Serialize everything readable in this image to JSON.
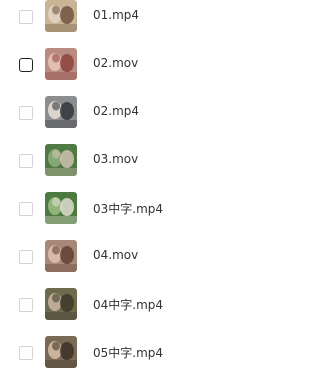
{
  "files": [
    {
      "name": "01.mp4",
      "checked": false,
      "hovered": false,
      "thumb": {
        "bg": "#c9b596",
        "a": "#e4d6c6",
        "b": "#6a4f3c"
      }
    },
    {
      "name": "02.mov",
      "checked": false,
      "hovered": true,
      "thumb": {
        "bg": "#b98b82",
        "a": "#e8c7b8",
        "b": "#8a3f3a"
      }
    },
    {
      "name": "02.mp4",
      "checked": false,
      "hovered": false,
      "thumb": {
        "bg": "#8c8d8e",
        "a": "#e7e1da",
        "b": "#2c2f35"
      }
    },
    {
      "name": "03.mov",
      "checked": false,
      "hovered": false,
      "thumb": {
        "bg": "#4f7a44",
        "a": "#8fb07c",
        "b": "#d7c4b7"
      }
    },
    {
      "name": "03中字.mp4",
      "checked": false,
      "hovered": false,
      "thumb": {
        "bg": "#4d7a3f",
        "a": "#9cbf82",
        "b": "#e8e2da"
      }
    },
    {
      "name": "04.mov",
      "checked": false,
      "hovered": false,
      "thumb": {
        "bg": "#a88876",
        "a": "#e1c3b4",
        "b": "#5c3b30"
      }
    },
    {
      "name": "04中字.mp4",
      "checked": false,
      "hovered": false,
      "thumb": {
        "bg": "#6e6a4e",
        "a": "#c9b7a4",
        "b": "#3b3527"
      }
    },
    {
      "name": "05中字.mp4",
      "checked": false,
      "hovered": false,
      "thumb": {
        "bg": "#7a6a55",
        "a": "#d8c0a7",
        "b": "#3a2e26"
      }
    }
  ]
}
